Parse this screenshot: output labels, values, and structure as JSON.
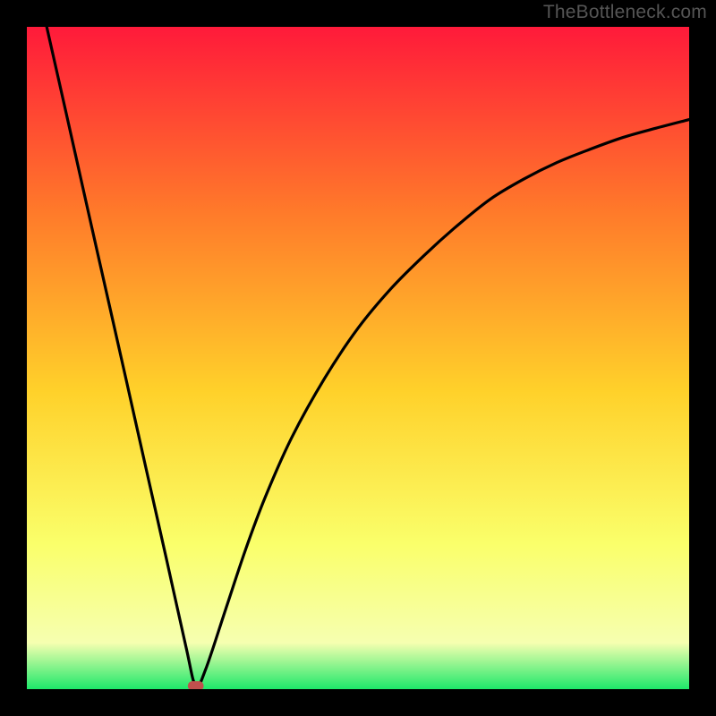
{
  "watermark": "TheBottleneck.com",
  "chart_data": {
    "type": "line",
    "title": "",
    "xlabel": "",
    "ylabel": "",
    "xlim": [
      0,
      100
    ],
    "ylim": [
      0,
      100
    ],
    "grid": false,
    "legend": false,
    "background_gradient": {
      "top": "#ff1a3a",
      "mid_upper": "#ff7a2a",
      "mid": "#ffd12a",
      "mid_lower": "#faff6a",
      "lower_band": "#f6ffb0",
      "bottom": "#1ee86a"
    },
    "series": [
      {
        "name": "bottleneck-curve",
        "color": "#000000",
        "x": [
          3,
          6,
          9,
          12,
          15,
          18,
          21,
          24,
          25.5,
          27,
          30,
          33,
          36,
          40,
          45,
          50,
          55,
          60,
          65,
          70,
          75,
          80,
          85,
          90,
          95,
          100
        ],
        "y": [
          100,
          86.7,
          73.3,
          60,
          46.7,
          33.3,
          20,
          6.5,
          0.5,
          3,
          12,
          21,
          29,
          38,
          47,
          54.5,
          60.5,
          65.5,
          70,
          74,
          77,
          79.5,
          81.5,
          83.3,
          84.7,
          86
        ]
      }
    ],
    "markers": [
      {
        "name": "min-point",
        "shape": "rounded-rect",
        "x": 25.5,
        "y": 0.5,
        "color": "#c0504d",
        "width_pct": 2.4,
        "height_pct": 1.4
      }
    ]
  }
}
